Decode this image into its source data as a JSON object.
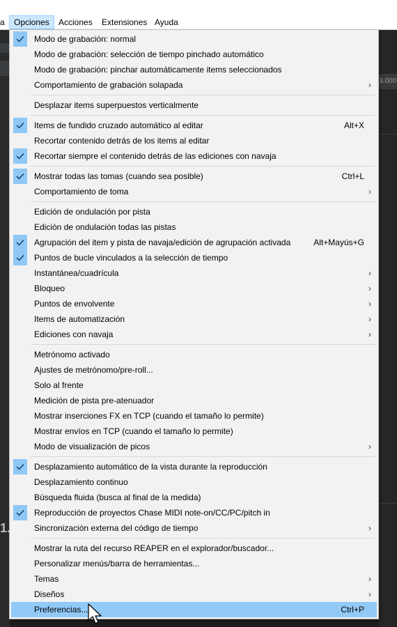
{
  "menubar": {
    "items": [
      "a",
      "Opciones",
      "Acciones",
      "Extensiones",
      "Ayuda"
    ],
    "active_index": 1
  },
  "background": {
    "ruler_text": "3.000",
    "left_text": "1."
  },
  "menu": {
    "items": [
      {
        "label": "Modo de grabación: normal",
        "checked": true
      },
      {
        "label": "Modo de grabación: selección de tiempo pinchado automático"
      },
      {
        "label": "Modo de grabación: pinchar automáticamente items seleccionados"
      },
      {
        "label": "Comportamiento de grabación solapada",
        "submenu": true
      },
      {
        "sep": true
      },
      {
        "label": "Desplazar items superpuestos verticalmente"
      },
      {
        "sep": true
      },
      {
        "label": "Items de fundido cruzado automático al editar",
        "checked": true,
        "shortcut": "Alt+X"
      },
      {
        "label": "Recortar contenido detrás de los items al editar"
      },
      {
        "label": "Recortar siempre el contenido detrás de las ediciones con navaja",
        "checked": true
      },
      {
        "sep": true
      },
      {
        "label": "Mostrar todas las tomas (cuando sea posible)",
        "checked": true,
        "shortcut": "Ctrl+L"
      },
      {
        "label": "Comportamiento de toma",
        "submenu": true
      },
      {
        "sep": true
      },
      {
        "label": "Edición de ondulación por pista"
      },
      {
        "label": "Edición de ondulación todas las pistas"
      },
      {
        "label": "Agrupación del item y pista de navaja/edición de agrupación activada",
        "checked": true,
        "shortcut": "Alt+Mayús+G"
      },
      {
        "label": "Puntos de bucle vinculados a la selección de tiempo",
        "checked": true
      },
      {
        "label": "Instantánea/cuadrícula",
        "submenu": true
      },
      {
        "label": "Bloqueo",
        "submenu": true
      },
      {
        "label": "Puntos de envolvente",
        "submenu": true
      },
      {
        "label": "Items de automatización",
        "submenu": true
      },
      {
        "label": "Ediciones con navaja",
        "submenu": true
      },
      {
        "sep": true
      },
      {
        "label": "Metrónomo activado"
      },
      {
        "label": "Ajustes de metrónomo/pre-roll..."
      },
      {
        "label": "Solo al frente"
      },
      {
        "label": "Medición de pista pre-atenuador"
      },
      {
        "label": "Mostrar inserciones FX en TCP (cuando el tamaño lo permite)"
      },
      {
        "label": "Mostrar envíos en TCP (cuando el tamaño lo permite)"
      },
      {
        "label": "Modo de visualización de picos",
        "submenu": true
      },
      {
        "sep": true
      },
      {
        "label": "Desplazamiento automático de la vista durante la reproducción",
        "checked": true
      },
      {
        "label": "Desplazamiento continuo"
      },
      {
        "label": "Búsqueda fluida (busca al final de la medida)"
      },
      {
        "label": "Reproducción de proyectos Chase MIDI note-on/CC/PC/pitch in",
        "checked": true
      },
      {
        "label": "Sincronización externa del código de tiempo",
        "submenu": true
      },
      {
        "sep": true
      },
      {
        "label": "Mostrar la ruta del recurso REAPER en el explorador/buscador..."
      },
      {
        "label": "Personalizar menús/barra de herramientas..."
      },
      {
        "label": "Temas",
        "submenu": true
      },
      {
        "label": "Diseños",
        "submenu": true
      },
      {
        "label": "Preferencias...",
        "shortcut": "Ctrl+P",
        "highlighted": true
      }
    ]
  },
  "icons": {
    "check": "check-icon",
    "submenu": "chevron-right-icon",
    "cursor": "mouse-pointer-icon"
  },
  "colors": {
    "menu_bg": "#f2f2f2",
    "highlight": "#91c9f7",
    "check_bg": "#8fc7f5",
    "menubar_active": "#cce8ff"
  }
}
